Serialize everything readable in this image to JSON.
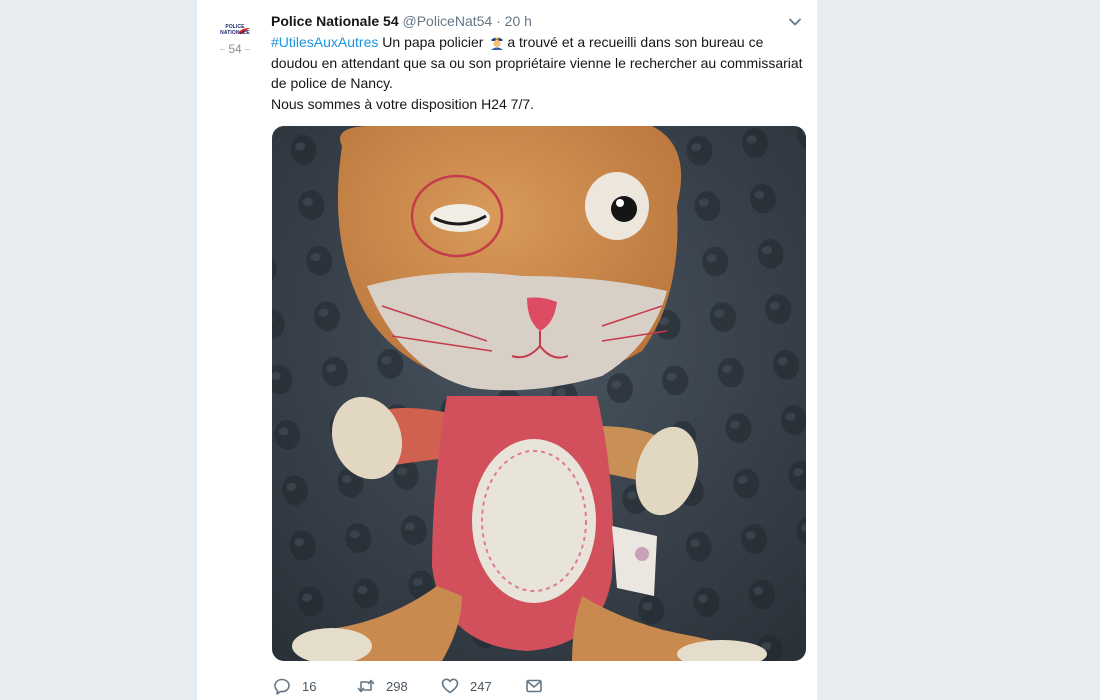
{
  "tweet": {
    "author_name": "Police Nationale 54",
    "author_handle": "@PoliceNat54",
    "separator": "·",
    "time": "20 h",
    "avatar_logo_text": "POLICE NATIONALE",
    "avatar_number": "54",
    "hashtag": "#UtilesAuxAutres",
    "text_line1_before_emoji": "  Un papa policier ",
    "text_line1_after_emoji": "a trouvé et a recueilli dans son bureau ce doudou en attendant que  sa ou son propriétaire vienne le rechercher au commissariat de police de Nancy.",
    "text_line2": "Nous sommes à votre disposition H24 7/7.",
    "emoji": "police-officer-emoji",
    "photo": "stuffed-cat-toy-photo"
  },
  "actions": {
    "replies": "16",
    "retweets": "298",
    "likes": "247"
  },
  "colors": {
    "background": "#e6ecf0",
    "card": "#ffffff",
    "hashtag": "#1b95e0",
    "text": "#14171a",
    "muted": "#657786"
  }
}
